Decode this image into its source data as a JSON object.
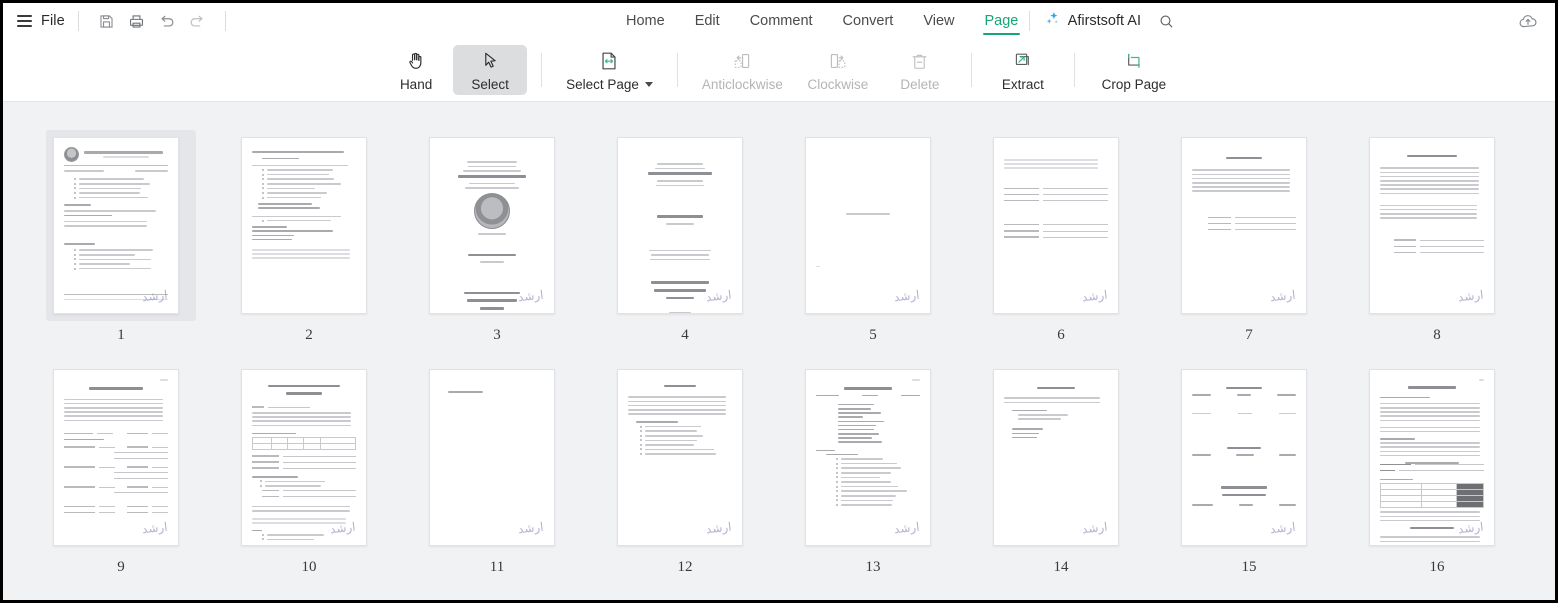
{
  "window": {
    "accent_green": "#17a673",
    "ai_blue": "#29a7e8",
    "thumb_bg": "#f1f2f4",
    "selected_bg": "#e4e6ea"
  },
  "menubar": {
    "menu_icon": "hamburger-icon",
    "file_label": "File",
    "quick_actions": [
      {
        "name": "save-icon",
        "label": "Save"
      },
      {
        "name": "print-icon",
        "label": "Print"
      },
      {
        "name": "undo-icon",
        "label": "Undo"
      },
      {
        "name": "redo-icon",
        "label": "Redo"
      }
    ],
    "tabs": [
      {
        "label": "Home",
        "active": false
      },
      {
        "label": "Edit",
        "active": false
      },
      {
        "label": "Comment",
        "active": false
      },
      {
        "label": "Convert",
        "active": false
      },
      {
        "label": "View",
        "active": false
      },
      {
        "label": "Page",
        "active": true
      }
    ],
    "ai_button": {
      "icon": "sparkle-icon",
      "label": "Afirstsoft AI"
    },
    "search_icon": "search-icon",
    "cloud_icon": "cloud-upload-icon"
  },
  "ribbon": {
    "tools": [
      {
        "label": "Hand",
        "icon": "hand-icon",
        "state": "enabled",
        "dropdown": false
      },
      {
        "label": "Select",
        "icon": "cursor-arrow-icon",
        "state": "active",
        "dropdown": false
      },
      {
        "label": "Select Page",
        "icon": "select-page-icon",
        "state": "enabled",
        "dropdown": true
      },
      {
        "label": "Anticlockwise",
        "icon": "rotate-left-icon",
        "state": "disabled",
        "dropdown": false
      },
      {
        "label": "Clockwise",
        "icon": "rotate-right-icon",
        "state": "disabled",
        "dropdown": false
      },
      {
        "label": "Delete",
        "icon": "trash-icon",
        "state": "disabled",
        "dropdown": false
      },
      {
        "label": "Extract",
        "icon": "extract-icon",
        "state": "enabled",
        "dropdown": false
      },
      {
        "label": "Crop Page",
        "icon": "crop-icon",
        "state": "enabled",
        "dropdown": false
      }
    ]
  },
  "thumbnails": {
    "signature_glyph": "ارشد",
    "pages": [
      {
        "number": "1",
        "selected": true,
        "kind": "letterhead",
        "title": "UNIVERSITY OF EDUCATION, LAHORE",
        "signature": true
      },
      {
        "number": "2",
        "selected": false,
        "kind": "outline",
        "title": "The thesis should include the following chapters:",
        "signature": false
      },
      {
        "number": "3",
        "selected": false,
        "kind": "titlepage",
        "title": "TYPE THESIS TITLE HERE",
        "signature": true
      },
      {
        "number": "4",
        "selected": false,
        "kind": "titlepage2",
        "title": "TYPE YOUR NAME HERE",
        "signature": true
      },
      {
        "number": "5",
        "selected": false,
        "kind": "blank",
        "title": "",
        "signature": true
      },
      {
        "number": "6",
        "selected": false,
        "kind": "signform",
        "title": "",
        "signature": true
      },
      {
        "number": "7",
        "selected": false,
        "kind": "declaration",
        "title": "DECLARATION",
        "signature": true
      },
      {
        "number": "8",
        "selected": false,
        "kind": "declaration2",
        "title": "PLAGIARISM UNDERTAKING",
        "signature": true
      },
      {
        "number": "9",
        "selected": false,
        "kind": "approval",
        "title": "CERTIFICATE OF APPROVAL",
        "signature": true
      },
      {
        "number": "10",
        "selected": false,
        "kind": "controller",
        "title": "OFFICE OF THE CONTROLLER OF EXAMINATIONS",
        "signature": true
      },
      {
        "number": "11",
        "selected": false,
        "kind": "nearblank",
        "title": "ACKNOWLEDGEMENTS",
        "signature": true
      },
      {
        "number": "12",
        "selected": false,
        "kind": "abstract",
        "title": "ABSTRACT",
        "signature": true
      },
      {
        "number": "13",
        "selected": false,
        "kind": "toc",
        "title": "TABLE OF CONTENTS",
        "signature": true
      },
      {
        "number": "14",
        "selected": false,
        "kind": "lists",
        "title": "LIST OF TABLES",
        "signature": true
      },
      {
        "number": "15",
        "selected": false,
        "kind": "lists2",
        "title": "LIST OF TABLES",
        "signature": true
      },
      {
        "number": "16",
        "selected": false,
        "kind": "guidelines",
        "title": "SUMMARY OF THESIS",
        "signature": true
      }
    ]
  }
}
